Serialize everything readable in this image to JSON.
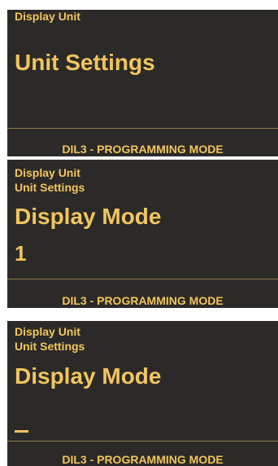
{
  "colors": {
    "background": "#2b2a29",
    "text": "#f2c55c",
    "divider": "#8c7a3f"
  },
  "screens": [
    {
      "breadcrumb": [
        "Display Unit"
      ],
      "title": "Unit Settings",
      "footer": "DIL3 - PROGRAMMING MODE"
    },
    {
      "breadcrumb": [
        "Display Unit",
        "Unit Settings"
      ],
      "title": "Display Mode",
      "value": "1",
      "footer": "DIL3 - PROGRAMMING MODE"
    },
    {
      "breadcrumb": [
        "Display Unit",
        "Unit Settings"
      ],
      "title": "Display Mode",
      "value_cursor": "underscore-cursor",
      "footer": "DIL3 - PROGRAMMING MODE"
    }
  ]
}
